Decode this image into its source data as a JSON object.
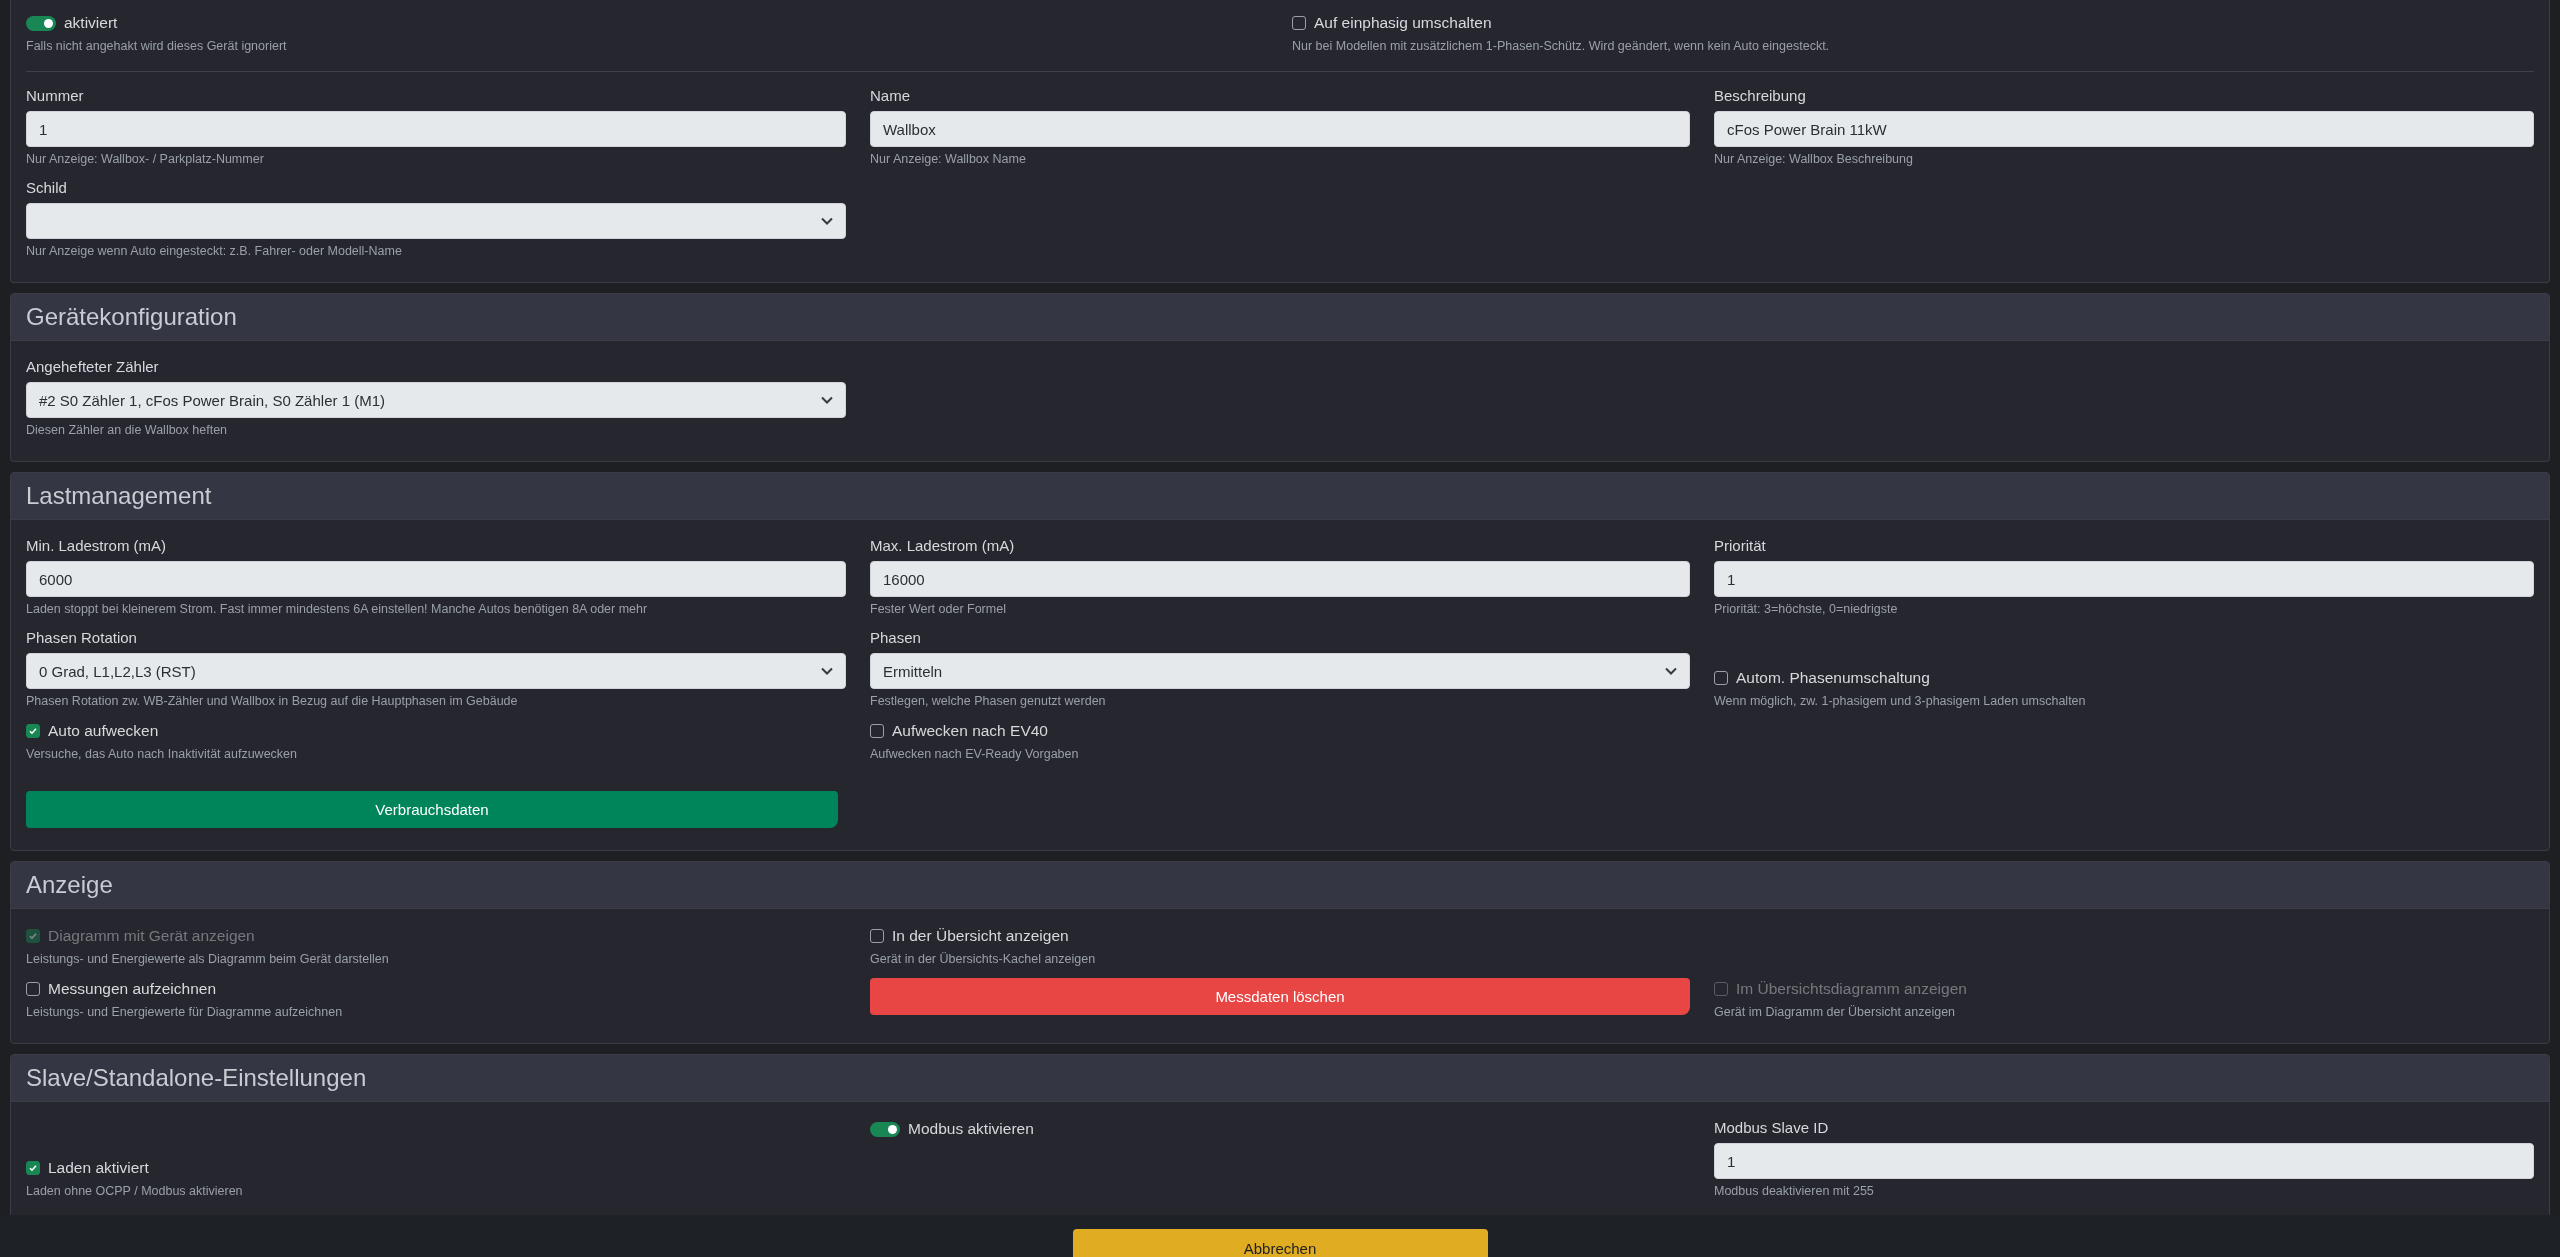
{
  "sections": [
    {
      "rows": [
        {
          "cells": [
            [
              {
                "kind": "toggle",
                "label": "aktiviert",
                "on": true,
                "hint": "Falls nicht angehakt wird dieses Gerät ignoriert"
              }
            ],
            [
              {
                "kind": "checkbox",
                "label": "Auf einphasig umschalten",
                "checked": false,
                "disabled": false,
                "hint": "Nur bei Modellen mit zusätzlichem 1-Phasen-Schütz. Wird geändert, wenn kein Auto eingesteckt."
              }
            ]
          ]
        },
        {
          "cells": [
            [
              {
                "kind": "field",
                "label": "Nummer",
                "value": "1",
                "hint": "Nur Anzeige: Wallbox- / Parkplatz-Nummer"
              }
            ],
            [
              {
                "kind": "field",
                "label": "Name",
                "value": "Wallbox",
                "hint": "Nur Anzeige: Wallbox Name"
              }
            ],
            [
              {
                "kind": "field",
                "label": "Beschreibung",
                "value": "cFos Power Brain 11kW",
                "hint": "Nur Anzeige: Wallbox Beschreibung"
              }
            ]
          ]
        },
        {
          "cells": [
            [
              {
                "kind": "select",
                "label": "Schild",
                "hint": "Nur Anzeige wenn Auto eingesteckt: z.B. Fahrer- oder Modell-Name"
              }
            ],
            null,
            null
          ]
        }
      ]
    },
    {
      "title": "Gerätekonfiguration",
      "rows": [
        {
          "cells": [
            [
              {
                "kind": "select",
                "label": "Angehefteter Zähler",
                "value": "#2 S0 Zähler 1, cFos Power Brain, S0 Zähler 1 (M1)",
                "hint": "Diesen Zähler an die Wallbox heften"
              }
            ],
            null,
            null
          ]
        }
      ]
    },
    {
      "title": "Lastmanagement",
      "rows": [
        {
          "cells": [
            [
              {
                "kind": "field",
                "label": "Min. Ladestrom (mA)",
                "value": "6000",
                "hint": "Laden stoppt bei kleinerem Strom. Fast immer mindestens 6A einstellen! Manche Autos benötigen 8A oder mehr"
              }
            ],
            [
              {
                "kind": "field",
                "label": "Max. Ladestrom (mA)",
                "value": "16000",
                "hint": "Fester Wert oder Formel"
              }
            ],
            [
              {
                "kind": "field",
                "label": "Priorität",
                "value": "1",
                "hint": "Priorität: 3=höchste, 0=niedrigste"
              }
            ]
          ]
        },
        {
          "cells": [
            [
              {
                "kind": "select",
                "label": "Phasen Rotation",
                "value": "0 Grad, L1,L2,L3 (RST)",
                "hint": "Phasen Rotation zw. WB-Zähler und Wallbox in Bezug auf die Hauptphasen im Gebäude"
              }
            ],
            [
              {
                "kind": "select",
                "label": "Phasen",
                "value": "Ermitteln",
                "hint": "Festlegen, welche Phasen genutzt werden"
              }
            ],
            [
              {
                "kind": "checkbox",
                "label": "Autom. Phasenumschaltung",
                "checked": false,
                "disabled": false,
                "hint": "Wenn möglich, zw. 1-phasigem und 3-phasigem Laden umschalten"
              }
            ]
          ]
        },
        {
          "cells": [
            [
              {
                "kind": "checkbox",
                "label": "Auto aufwecken",
                "checked": true,
                "disabled": false,
                "hint": "Versuche, das Auto nach Inaktivität aufzuwecken"
              }
            ],
            [
              {
                "kind": "checkbox",
                "label": "Aufwecken nach EV40",
                "checked": false,
                "disabled": false,
                "hint": "Aufwecken nach EV-Ready Vorgaben"
              }
            ],
            null
          ]
        },
        {
          "cells": [
            [
              {
                "kind": "button",
                "label": "Verbrauchsdaten"
              }
            ],
            null,
            null
          ]
        }
      ]
    },
    {
      "title": "Anzeige",
      "rows": [
        {
          "cells": [
            [
              {
                "kind": "checkbox",
                "label": "Diagramm mit Gerät anzeigen",
                "checked": true,
                "disabled": true,
                "hint": "Leistungs- und Energiewerte als Diagramm beim Gerät darstellen"
              },
              {
                "kind": "checkbox",
                "label": "Messungen aufzeichnen",
                "checked": false,
                "disabled": false,
                "hint": "Leistungs- und Energiewerte für Diagramme aufzeichnen"
              }
            ],
            [
              {
                "kind": "checkbox",
                "label": "In der Übersicht anzeigen",
                "checked": false,
                "disabled": false,
                "hint": "Gerät in der Übersichts-Kachel anzeigen"
              },
              {
                "kind": "delete_button",
                "label": "Messdaten löschen"
              }
            ],
            [
              {
                "kind": "checkbox",
                "label": "Im Übersichtsdiagramm anzeigen",
                "checked": false,
                "disabled": true,
                "hint": "Gerät im Diagramm der Übersicht anzeigen"
              }
            ]
          ]
        }
      ]
    },
    {
      "title": "Slave/Standalone-Einstellungen",
      "rows": [
        {
          "cells": [
            [
              {
                "kind": "checkbox",
                "label": "Laden aktiviert",
                "checked": true,
                "disabled": false,
                "hint": "Laden ohne OCPP / Modbus aktivieren"
              }
            ],
            [
              {
                "kind": "toggle",
                "label": "Modbus aktivieren",
                "on": true
              }
            ],
            [
              {
                "kind": "field",
                "label": "Modbus Slave ID",
                "value": "1",
                "hint": "Modbus deaktivieren mit 255"
              }
            ]
          ]
        }
      ]
    }
  ],
  "footer": {
    "button": "Abbrechen"
  }
}
